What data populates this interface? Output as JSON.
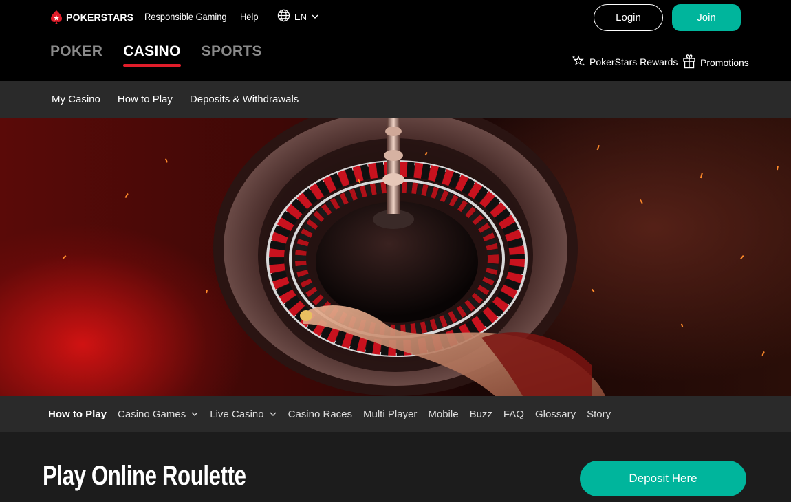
{
  "header": {
    "brand": "POKERSTARS",
    "links": {
      "responsible_gaming": "Responsible Gaming",
      "help": "Help"
    },
    "language": "EN",
    "login_label": "Login",
    "join_label": "Join",
    "verticals": [
      {
        "label": "POKER",
        "active": false
      },
      {
        "label": "CASINO",
        "active": true
      },
      {
        "label": "SPORTS",
        "active": false
      }
    ],
    "rewards_label": "PokerStars Rewards",
    "promotions_label": "Promotions",
    "colors": {
      "accent": "#00b59c",
      "brand_red": "#e11d2a"
    }
  },
  "sub_nav": {
    "items": [
      "My Casino",
      "How to Play",
      "Deposits & Withdrawals"
    ]
  },
  "section_nav": {
    "items": [
      {
        "label": "How to Play",
        "active": true,
        "dropdown": false
      },
      {
        "label": "Casino Games",
        "active": false,
        "dropdown": true
      },
      {
        "label": "Live Casino",
        "active": false,
        "dropdown": true
      },
      {
        "label": "Casino Races",
        "active": false,
        "dropdown": false
      },
      {
        "label": "Multi Player",
        "active": false,
        "dropdown": false
      },
      {
        "label": "Mobile",
        "active": false,
        "dropdown": false
      },
      {
        "label": "Buzz",
        "active": false,
        "dropdown": false
      },
      {
        "label": "FAQ",
        "active": false,
        "dropdown": false
      },
      {
        "label": "Glossary",
        "active": false,
        "dropdown": false
      },
      {
        "label": "Story",
        "active": false,
        "dropdown": false
      }
    ]
  },
  "main": {
    "title": "Play Online Roulette",
    "deposit_label": "Deposit Here"
  }
}
